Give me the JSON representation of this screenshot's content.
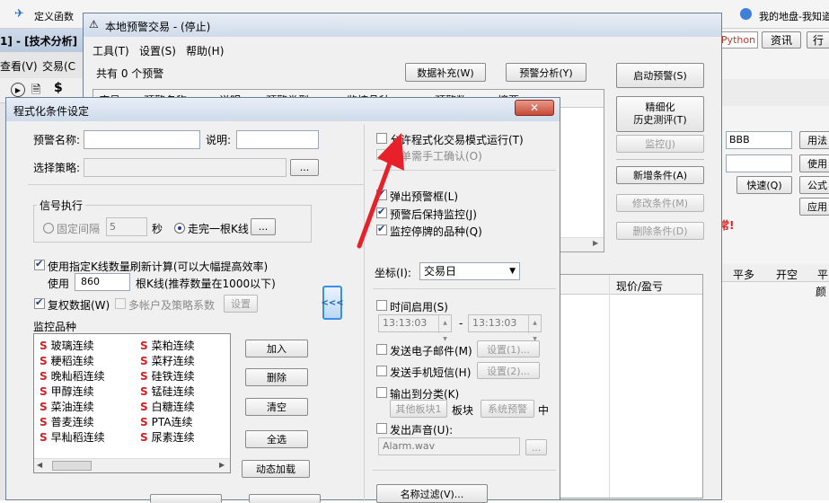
{
  "bg": {
    "topbar_items": [
      "定义函数",
      "我的地盘-我知道"
    ],
    "left_title": "1] - [技术分析]",
    "left_menu": [
      "查看(V)",
      "交易(C"
    ],
    "right_buttons": [
      "Python",
      "资讯",
      "行"
    ],
    "right_side": {
      "bbb": "BBB",
      "btn1": "用法",
      "btn2": "使用",
      "quick": "快速(Q)",
      "btn3": "公式",
      "btn4": "应用",
      "alert": "常!",
      "col_headers": [
        "平多",
        "开空",
        "平"
      ],
      "cell": "颜"
    }
  },
  "back_dialog": {
    "title": "本地预警交易 - (停止)",
    "menu": [
      "工具(T)",
      "设置(S)",
      "帮助(H)"
    ],
    "count_label": "共有 0 个预警",
    "btn_data": "数据补充(W)",
    "btn_analysis": "预警分析(Y)",
    "btn_start": "启动预警(S)",
    "btn_refine_1": "精细化",
    "btn_refine_2": "历史测评(T)",
    "btn_monitor": "监控(J)",
    "btn_new": "新增条件(A)",
    "btn_modify": "修改条件(M)",
    "btn_delete": "删除条件(D)",
    "col_headers": [
      "序号",
      "预警名称",
      "说明",
      "预警类型",
      "监控品种",
      "预警数",
      "摘要"
    ],
    "lower_headers": [
      "现价/盈亏"
    ]
  },
  "dialog": {
    "title": "程式化条件设定",
    "name_label": "预警名称:",
    "name_value": "",
    "desc_label": "说明:",
    "desc_value": "",
    "strategy_label": "选择策略:",
    "strategy_value": "",
    "browse": "...",
    "signal": {
      "title": "信号执行",
      "fixed_label": "固定间隔",
      "fixed_value": "5",
      "sec": "秒",
      "bar_label": "走完一根K线",
      "bar_btn": "..."
    },
    "refresh_label": "使用指定K线数量刷新计算(可以大幅提高效率)",
    "use_label": "使用",
    "use_value": "860",
    "bars_label": "根K线(推荐数量在1000以下)",
    "fq_label": "复权数据(W)",
    "multi_label": "多帐户及策略系数",
    "settings": "设置",
    "collapse_btn": "<<<",
    "monitor": {
      "title": "监控品种",
      "col1": [
        "玻璃连续",
        "粳稻连续",
        "晚籼稻连续",
        "甲醇连续",
        "菜油连续",
        "普麦连续",
        "早籼稻连续"
      ],
      "col2": [
        "菜粕连续",
        "菜籽连续",
        "硅铁连续",
        "锰硅连续",
        "白糖连续",
        "PTA连续",
        "尿素连续"
      ],
      "marker": "S",
      "btn_add": "加入",
      "btn_del": "删除",
      "btn_clear": "清空",
      "btn_all": "全选",
      "btn_dyn": "动态加载"
    },
    "right": {
      "allow_prog": "允许程式化交易模式运行(T)",
      "manual_confirm": "下单需手工确认(O)",
      "popup": "弹出预警框(L)",
      "keep_monitor": "预警后保持监控(J)",
      "suspend": "监控停牌的品种(Q)",
      "coord_label": "坐标(I):",
      "coord_value": "交易日",
      "time_enable": "时间启用(S)",
      "time_from": "13:13:03",
      "time_dash": "-",
      "time_to": "13:13:03",
      "email": "发送电子邮件(M)",
      "email_set": "设置(1)...",
      "sms": "发送手机短信(H)",
      "sms_set": "设置(2)...",
      "output": "输出到分类(K)",
      "other_block": "其他板块1",
      "block_label": "板块",
      "system_alert": "系统预警",
      "zhong": "中",
      "sound": "发出声音(U):",
      "sound_file": "Alarm.wav",
      "sound_btn": "...",
      "name_filter": "名称过滤(V)..."
    }
  },
  "colors": {
    "accent_arrow": "#e8202a",
    "title_blue": "#cfdbea",
    "s_marker": "#d42020"
  }
}
